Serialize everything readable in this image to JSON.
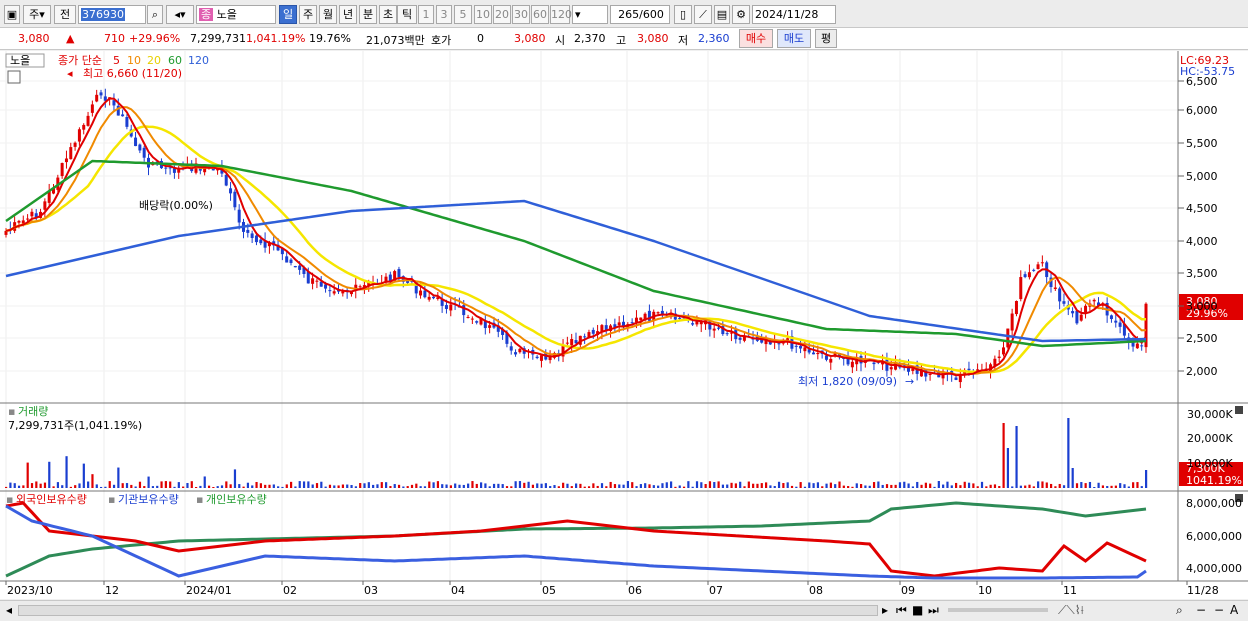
{
  "toolbar": {
    "market": "주",
    "prev": "전",
    "code": "376930",
    "stock_prefix": "종",
    "stock": "노을",
    "periods": [
      "일",
      "주",
      "월",
      "년",
      "분",
      "초",
      "틱"
    ],
    "minutes": [
      "1",
      "3",
      "5",
      "10",
      "20",
      "30",
      "60",
      "120"
    ],
    "count": "265",
    "count_max": "/600",
    "date": "2024/11/28"
  },
  "info": {
    "price": "3,080",
    "change": "710",
    "change_pct": "+29.96%",
    "volume": "7,299,731",
    "volume_pct": "1,041.19%",
    "turnover": "19.76%",
    "amount": "21,073백만",
    "hoga_label": "호가",
    "hoga": "0",
    "hoga_price": "3,080",
    "open_label": "시",
    "open": "2,370",
    "high_label": "고",
    "high": "3,080",
    "low_label": "저",
    "low": "2,360",
    "buy": "매수",
    "sell": "매도",
    "avg": "평"
  },
  "price_panel": {
    "name": "노을",
    "ma_label": "종가 단순",
    "ma": [
      "5",
      "10",
      "20",
      "60",
      "120"
    ],
    "lc": "LC:69.23",
    "hc": "HC:-53.75",
    "high_note": "최고 6,660 (11/20)",
    "low_note": "최저 1,820 (09/09)",
    "dividend": "배당락(0.00%)",
    "y_ticks": [
      "6,500",
      "6,000",
      "5,500",
      "5,000",
      "4,500",
      "4,000",
      "3,500",
      "3,000",
      "2,500",
      "2,000"
    ],
    "last_price": "3,080",
    "last_pct": "29.96%"
  },
  "volume_panel": {
    "label": "거래량",
    "value": "7,299,731주(1,041.19%)",
    "y_ticks": [
      "30,000K",
      "20,000K",
      "10,000K"
    ],
    "last": "7,300K",
    "last_pct": "1041.19%"
  },
  "holder_panel": {
    "labels": [
      "외국인보유수량",
      "기관보유수량",
      "개인보유수량"
    ],
    "y_ticks": [
      "8,000,000",
      "6,000,000",
      "4,000,000"
    ]
  },
  "x_axis": [
    "2023/10",
    "12",
    "2024/01",
    "02",
    "03",
    "04",
    "05",
    "06",
    "07",
    "08",
    "09",
    "10",
    "11",
    "11/28"
  ],
  "colors": {
    "up": "#e00000",
    "down": "#1a3ed0",
    "ma5": "#e00000",
    "ma10": "#f08a00",
    "ma20": "#f5e600",
    "ma60": "#1f9a2e",
    "ma120": "#2f5fd8"
  }
}
